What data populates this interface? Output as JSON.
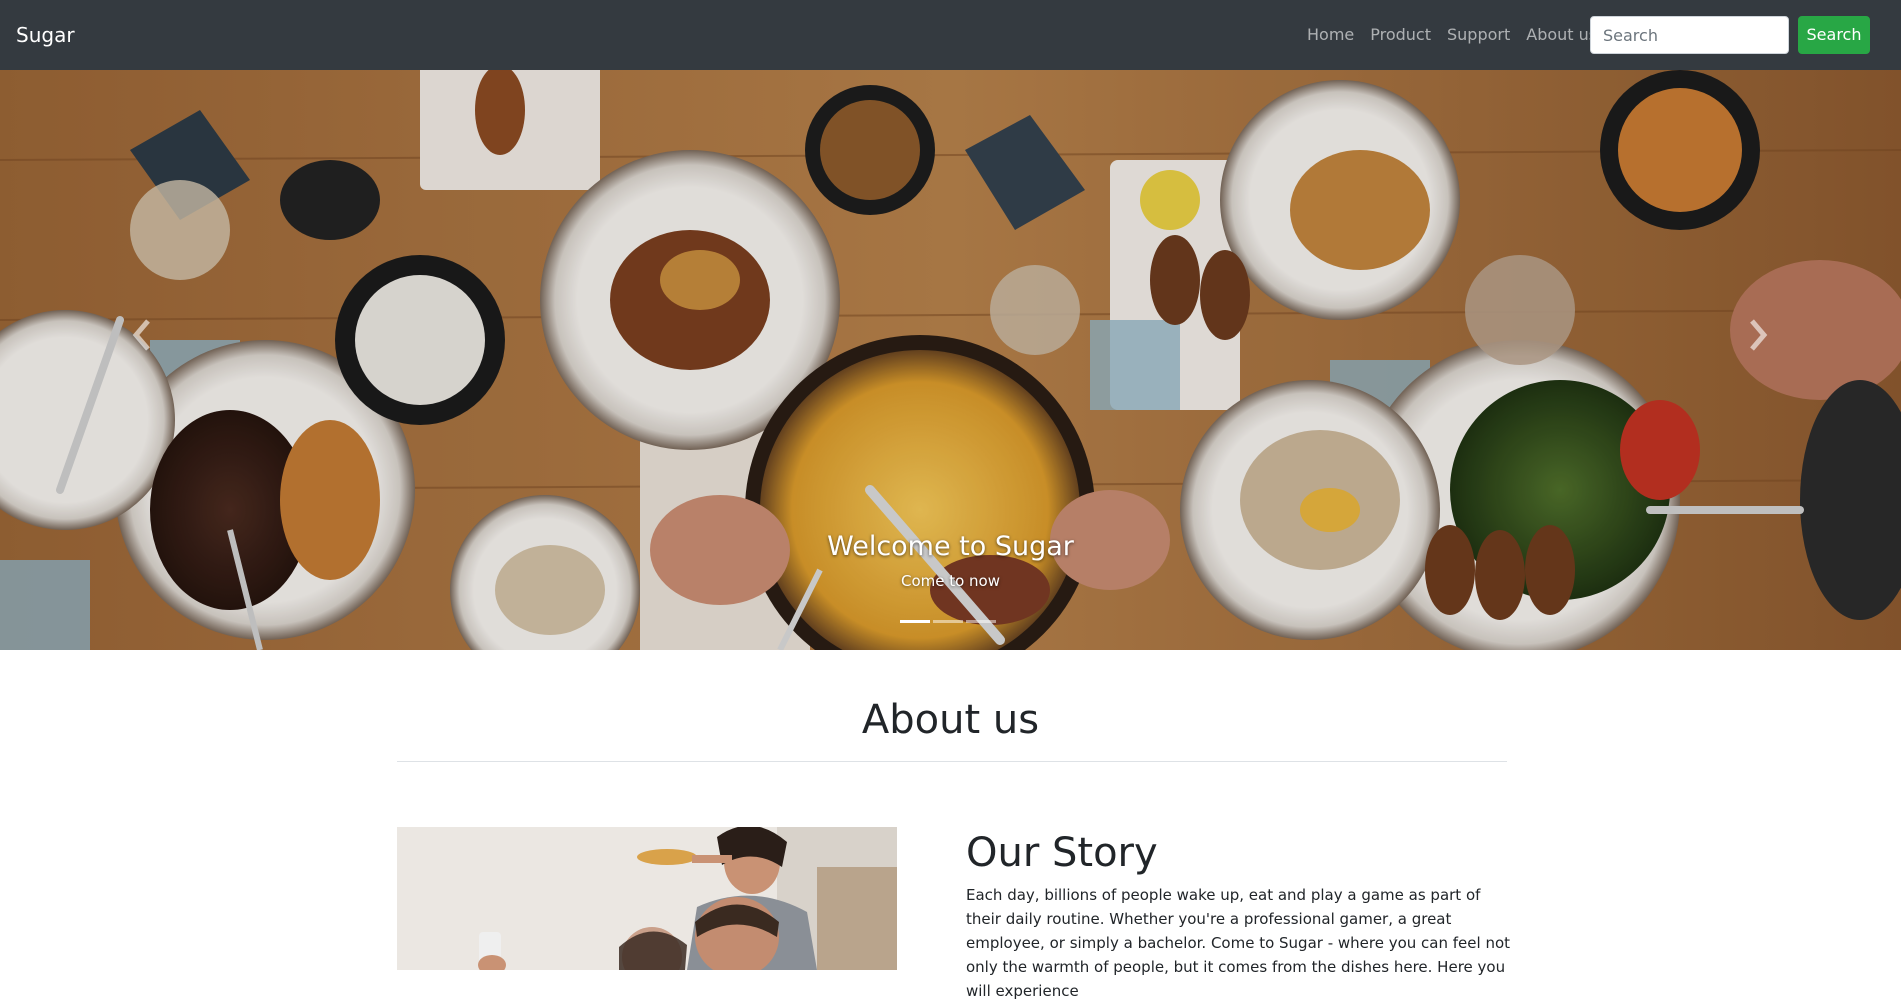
{
  "navbar": {
    "brand": "Sugar",
    "links": [
      "Home",
      "Product",
      "Support",
      "About us"
    ],
    "search_placeholder": "Search",
    "search_button": "Search",
    "background": "#343a40",
    "button_color": "#28a745"
  },
  "carousel": {
    "caption_title": "Welcome to Sugar",
    "caption_subtitle": "Come to now",
    "indicator_count": 3,
    "active_indicator": 1,
    "prev_icon": "chevron-left-icon",
    "next_icon": "chevron-right-icon",
    "image": "food-table-photo"
  },
  "about": {
    "heading": "About us",
    "story_title": "Our Story",
    "story_text": "Each day, billions of people wake up, eat and play a game as part of their daily routine. Whether you're a professional gamer, a great employee, or simply a bachelor. Come to Sugar - where you can feel not only the warmth of people, but it comes from the dishes here. Here you will experience",
    "story_image": "friends-eating-pizza-photo"
  }
}
